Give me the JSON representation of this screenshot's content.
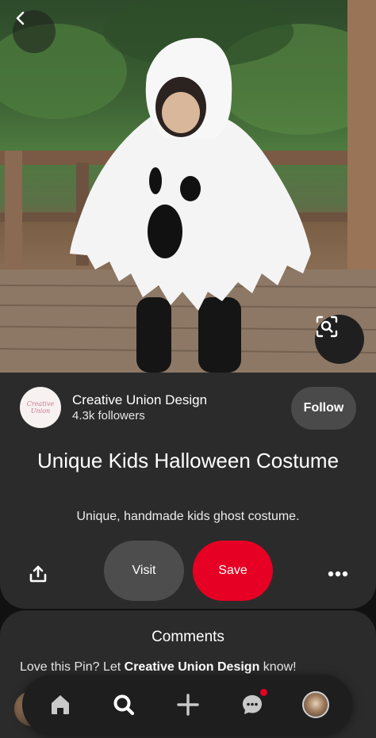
{
  "creator": {
    "name": "Creative Union Design",
    "followers": "4.3k followers",
    "avatar_text": "Creative Union",
    "follow_label": "Follow"
  },
  "pin": {
    "title": "Unique Kids Halloween Costume",
    "description": "Unique, handmade kids ghost costume."
  },
  "actions": {
    "share_icon": "share-icon",
    "visit_label": "Visit",
    "save_label": "Save",
    "more_icon": "more-icon"
  },
  "comments": {
    "title": "Comments",
    "prompt_prefix": "Love this Pin? Let ",
    "prompt_name": "Creative Union Design",
    "prompt_suffix": " know!"
  },
  "nav": {
    "items": [
      "home-icon",
      "search-icon",
      "plus-icon",
      "chat-icon",
      "profile-avatar"
    ],
    "active": "search-icon"
  },
  "colors": {
    "background": "#111111",
    "card": "#2b2b2b",
    "save_red": "#e60023",
    "button_gray": "#4d4d4d",
    "nav_bg": "#1e1e1e"
  }
}
